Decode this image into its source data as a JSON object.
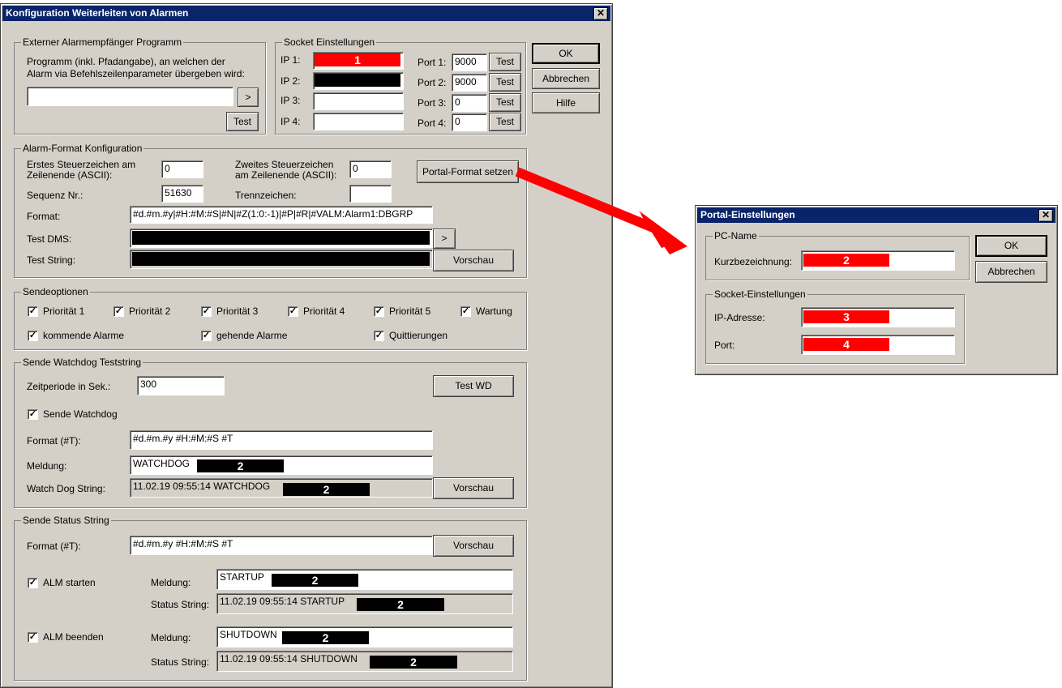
{
  "main_dialog": {
    "title": "Konfiguration Weiterleiten von Alarmen",
    "close": "✕",
    "buttons": {
      "ok": "OK",
      "cancel": "Abbrechen",
      "help": "Hilfe"
    },
    "external": {
      "title": "Externer Alarmempfänger Programm",
      "desc1": "Programm (inkl. Pfadangabe), an welchen der",
      "desc2": "Alarm via Befehlszeilenparameter übergeben wird:",
      "program_value": "",
      "browse": ">",
      "test": "Test"
    },
    "socket": {
      "title": "Socket Einstellungen",
      "rows": [
        {
          "ip_label": "IP 1:",
          "ip_marker": "1",
          "port_label": "Port 1:",
          "port": "9000",
          "test": "Test"
        },
        {
          "ip_label": "IP 2:",
          "ip_marker": "",
          "port_label": "Port 2:",
          "port": "9000",
          "test": "Test"
        },
        {
          "ip_label": "IP 3:",
          "ip_marker": "",
          "port_label": "Port 3:",
          "port": "0",
          "test": "Test"
        },
        {
          "ip_label": "IP 4:",
          "ip_marker": "",
          "port_label": "Port 4:",
          "port": "0",
          "test": "Test"
        }
      ]
    },
    "alarm_format": {
      "title": "Alarm-Format Konfiguration",
      "first_ctrl_label1": "Erstes Steuerzeichen am",
      "first_ctrl_label2": "Zeilenende (ASCII):",
      "first_ctrl_value": "0",
      "second_ctrl_label1": "Zweites Steuerzeichen",
      "second_ctrl_label2": "am Zeilenende (ASCII):",
      "second_ctrl_value": "0",
      "portal_button": "Portal-Format setzen",
      "seq_label": "Sequenz Nr.:",
      "seq_value": "51630",
      "separator_label": "Trennzeichen:",
      "separator_value": "",
      "format_label": "Format:",
      "format_value": "#d.#m.#y|#H:#M:#S|#N|#Z(1:0:-1)|#P|#R|#VALM:Alarm1:DBGRP",
      "test_dms_label": "Test DMS:",
      "test_dms_browse": ">",
      "test_string_label": "Test String:",
      "preview": "Vorschau"
    },
    "send_options": {
      "title": "Sendeoptionen",
      "row1": [
        {
          "label": "Priorität 1",
          "checked": true
        },
        {
          "label": "Priorität 2",
          "checked": true
        },
        {
          "label": "Priorität 3",
          "checked": true
        },
        {
          "label": "Priorität 4",
          "checked": true
        },
        {
          "label": "Priorität 5",
          "checked": true
        },
        {
          "label": "Wartung",
          "checked": true
        }
      ],
      "row2": [
        {
          "label": "kommende Alarme",
          "checked": true
        },
        {
          "label": "gehende Alarme",
          "checked": true
        },
        {
          "label": "Quittierungen",
          "checked": true
        }
      ]
    },
    "watchdog": {
      "title": "Sende Watchdog Teststring",
      "period_label": "Zeitperiode in Sek.:",
      "period_value": "300",
      "test_wd": "Test WD",
      "send_label": "Sende Watchdog",
      "send_checked": true,
      "format_label": "Format (#T):",
      "format_value": "#d.#m.#y #H:#M:#S #T",
      "message_label": "Meldung:",
      "message_value": "WATCHDOG",
      "message_marker": "2",
      "string_label": "Watch Dog String:",
      "string_value": "11.02.19 09:55:14 WATCHDOG",
      "string_marker": "2",
      "preview": "Vorschau"
    },
    "status": {
      "title": "Sende Status String",
      "format_label": "Format (#T):",
      "format_value": "#d.#m.#y #H:#M:#S #T",
      "preview": "Vorschau",
      "start_label": "ALM starten",
      "start_checked": true,
      "start_message_label": "Meldung:",
      "start_message_value": "STARTUP",
      "start_message_marker": "2",
      "start_string_label": "Status String:",
      "start_string_value": "11.02.19 09:55:14 STARTUP",
      "start_string_marker": "2",
      "stop_label": "ALM beenden",
      "stop_checked": true,
      "stop_message_label": "Meldung:",
      "stop_message_value": "SHUTDOWN",
      "stop_message_marker": "2",
      "stop_string_label": "Status String:",
      "stop_string_value": "11.02.19 09:55:14 SHUTDOWN",
      "stop_string_marker": "2"
    }
  },
  "portal_dialog": {
    "title": "Portal-Einstellungen",
    "close": "✕",
    "pc_group": "PC-Name",
    "short_label": "Kurzbezeichnung:",
    "short_marker": "2",
    "socket_group": "Socket-Einstellungen",
    "ip_label": "IP-Adresse:",
    "ip_marker": "3",
    "port_label": "Port:",
    "port_marker": "4",
    "ok": "OK",
    "cancel": "Abbrechen"
  },
  "annotation_colors": {
    "arrow": "#ff0000",
    "highlight": "#ff0000",
    "redaction": "#000000"
  }
}
